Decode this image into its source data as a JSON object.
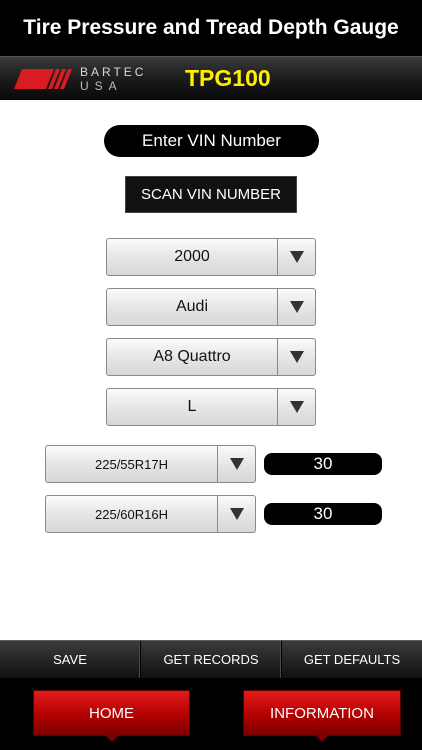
{
  "app": {
    "title": "Tire Pressure and Tread Depth Gauge",
    "brand_name": "BARTEC",
    "brand_region": "USA",
    "model": "TPG100",
    "accent_color": "#ffee00",
    "brand_color": "#d81c22"
  },
  "vin": {
    "placeholder": "Enter VIN Number",
    "scan_label": "SCAN VIN NUMBER"
  },
  "vehicle": {
    "year": "2000",
    "make": "Audi",
    "model": "A8 Quattro",
    "trim": "L"
  },
  "tires": [
    {
      "size": "225/55R17H",
      "pressure": "30"
    },
    {
      "size": "225/60R16H",
      "pressure": "30"
    }
  ],
  "toolbar": {
    "save": "SAVE",
    "get_records": "GET RECORDS",
    "get_defaults": "GET DEFAULTS"
  },
  "nav": {
    "home": "HOME",
    "information": "INFORMATION"
  }
}
